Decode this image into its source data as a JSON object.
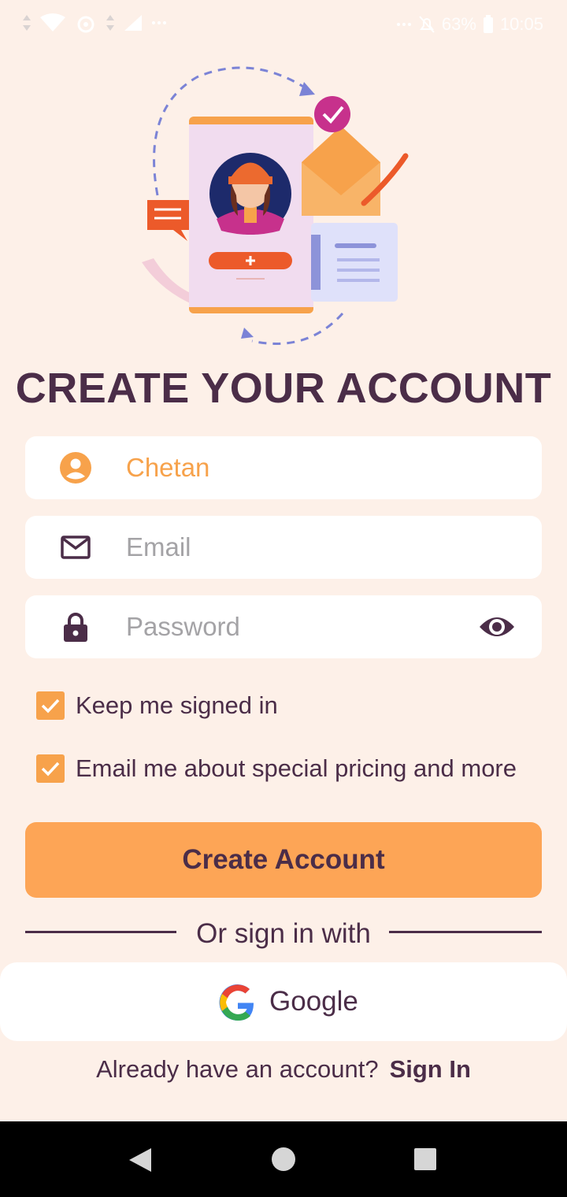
{
  "status_bar": {
    "battery": "63%",
    "time": "10:05"
  },
  "title": "CREATE YOUR ACCOUNT",
  "form": {
    "name": {
      "value": "Chetan",
      "icon": "account-circle-icon"
    },
    "email": {
      "placeholder": "Email",
      "icon": "mail-icon"
    },
    "password": {
      "placeholder": "Password",
      "icon": "lock-icon",
      "toggle_icon": "eye-icon"
    }
  },
  "checkboxes": {
    "keep_signed_in": {
      "label": "Keep me signed in",
      "checked": true
    },
    "email_pricing": {
      "label": "Email me about special pricing and more",
      "checked": true
    }
  },
  "create_button": "Create Account",
  "divider_text": "Or sign in with",
  "google_button": "Google",
  "signin": {
    "prompt": "Already have an account?",
    "link": "Sign In"
  },
  "colors": {
    "background": "#fdf0e8",
    "primary_text": "#4b2d48",
    "accent": "#f7a24b",
    "button": "#fda556"
  }
}
